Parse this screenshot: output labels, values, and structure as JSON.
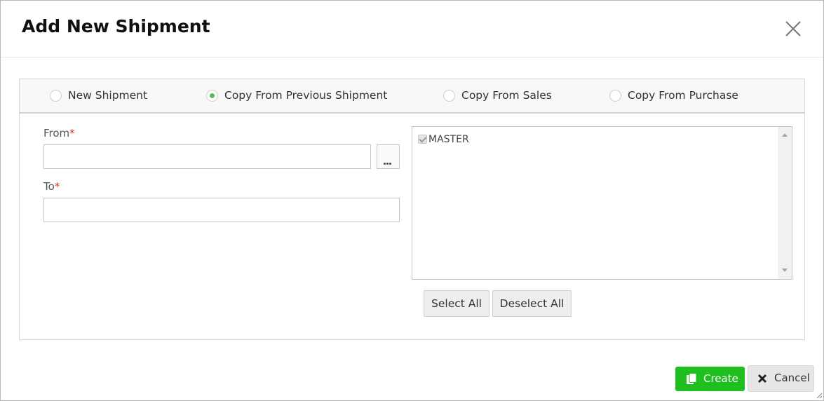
{
  "dialog": {
    "title": "Add New Shipment"
  },
  "shipment_type": {
    "options": [
      {
        "label": "New Shipment",
        "checked": false
      },
      {
        "label": "Copy From Previous Shipment",
        "checked": true
      },
      {
        "label": "Copy From Sales",
        "checked": false
      },
      {
        "label": "Copy From Purchase",
        "checked": false
      }
    ],
    "accent_color": "#5cb85c"
  },
  "form": {
    "from_label": "From",
    "to_label": "To",
    "required_marker": "*",
    "from_value": "",
    "to_value": ""
  },
  "company_list": {
    "items": [
      {
        "label": "MASTER",
        "checked": true,
        "disabled": true
      }
    ]
  },
  "list_actions": {
    "select_all": "Select All",
    "deselect_all": "Deselect All"
  },
  "footer": {
    "create_label": "Create",
    "cancel_label": "Cancel",
    "create_color": "#1fbf1f"
  },
  "icons": {
    "close": "close-icon",
    "ellipsis": "ellipsis-icon",
    "copy": "copy-icon",
    "cancel": "x-icon"
  }
}
